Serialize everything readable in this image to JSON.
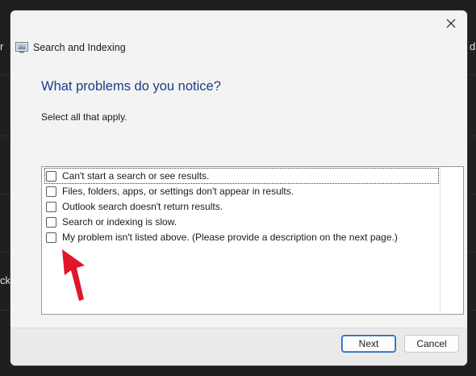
{
  "backdrop": {
    "left_fragment_top": "r",
    "right_fragment_top": "d",
    "left_fragment_mid": "ck"
  },
  "window": {
    "title": "Search and Indexing",
    "heading": "What problems do you notice?",
    "instruction": "Select all that apply."
  },
  "options": [
    {
      "label": "Can't start a search or see results.",
      "checked": false
    },
    {
      "label": "Files, folders, apps, or settings don't appear in results.",
      "checked": false
    },
    {
      "label": "Outlook search doesn't return results.",
      "checked": false
    },
    {
      "label": "Search or indexing is slow.",
      "checked": false
    },
    {
      "label": "My problem isn't listed above. (Please provide a description on the next page.)",
      "checked": false
    }
  ],
  "buttons": {
    "next": "Next",
    "cancel": "Cancel"
  },
  "colors": {
    "heading": "#1a3c8c",
    "annotation_arrow": "#e0162b",
    "primary_border": "#1a5fb4"
  }
}
